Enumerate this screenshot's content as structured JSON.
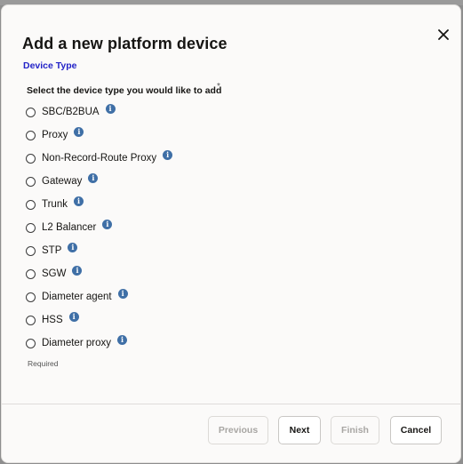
{
  "dialog": {
    "title": "Add a new platform device",
    "close_icon": "close-icon"
  },
  "step": {
    "label": "Device Type"
  },
  "question": {
    "text": "Select the device type you would like to add",
    "required_marker": "*"
  },
  "options": [
    {
      "label": "SBC/B2BUA",
      "selected": false,
      "info_icon": "info-icon"
    },
    {
      "label": "Proxy",
      "selected": false,
      "info_icon": "info-icon"
    },
    {
      "label": "Non-Record-Route Proxy",
      "selected": false,
      "info_icon": "info-icon"
    },
    {
      "label": "Gateway",
      "selected": false,
      "info_icon": "info-icon"
    },
    {
      "label": "Trunk",
      "selected": false,
      "info_icon": "info-icon"
    },
    {
      "label": "L2 Balancer",
      "selected": false,
      "info_icon": "info-icon"
    },
    {
      "label": "STP",
      "selected": false,
      "info_icon": "info-icon"
    },
    {
      "label": "SGW",
      "selected": false,
      "info_icon": "info-icon"
    },
    {
      "label": "Diameter agent",
      "selected": false,
      "info_icon": "info-icon"
    },
    {
      "label": "HSS",
      "selected": false,
      "info_icon": "info-icon"
    },
    {
      "label": "Diameter proxy",
      "selected": false,
      "info_icon": "info-icon"
    }
  ],
  "required_note": "Required",
  "info_glyph": "i",
  "footer": {
    "previous_label": "Previous",
    "next_label": "Next",
    "finish_label": "Finish",
    "cancel_label": "Cancel"
  },
  "colors": {
    "step_label": "#2323c8",
    "info_icon": "#3f6fa6",
    "dialog_bg": "#fbfaf9",
    "disabled_text": "#a8a6a3"
  }
}
